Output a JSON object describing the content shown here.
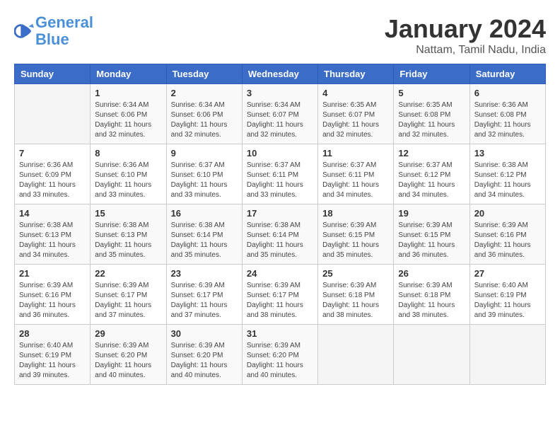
{
  "header": {
    "logo_line1": "General",
    "logo_line2": "Blue",
    "month_title": "January 2024",
    "subtitle": "Nattam, Tamil Nadu, India"
  },
  "weekdays": [
    "Sunday",
    "Monday",
    "Tuesday",
    "Wednesday",
    "Thursday",
    "Friday",
    "Saturday"
  ],
  "weeks": [
    [
      {
        "day": "",
        "info": ""
      },
      {
        "day": "1",
        "info": "Sunrise: 6:34 AM\nSunset: 6:06 PM\nDaylight: 11 hours\nand 32 minutes."
      },
      {
        "day": "2",
        "info": "Sunrise: 6:34 AM\nSunset: 6:06 PM\nDaylight: 11 hours\nand 32 minutes."
      },
      {
        "day": "3",
        "info": "Sunrise: 6:34 AM\nSunset: 6:07 PM\nDaylight: 11 hours\nand 32 minutes."
      },
      {
        "day": "4",
        "info": "Sunrise: 6:35 AM\nSunset: 6:07 PM\nDaylight: 11 hours\nand 32 minutes."
      },
      {
        "day": "5",
        "info": "Sunrise: 6:35 AM\nSunset: 6:08 PM\nDaylight: 11 hours\nand 32 minutes."
      },
      {
        "day": "6",
        "info": "Sunrise: 6:36 AM\nSunset: 6:08 PM\nDaylight: 11 hours\nand 32 minutes."
      }
    ],
    [
      {
        "day": "7",
        "info": "Sunrise: 6:36 AM\nSunset: 6:09 PM\nDaylight: 11 hours\nand 33 minutes."
      },
      {
        "day": "8",
        "info": "Sunrise: 6:36 AM\nSunset: 6:10 PM\nDaylight: 11 hours\nand 33 minutes."
      },
      {
        "day": "9",
        "info": "Sunrise: 6:37 AM\nSunset: 6:10 PM\nDaylight: 11 hours\nand 33 minutes."
      },
      {
        "day": "10",
        "info": "Sunrise: 6:37 AM\nSunset: 6:11 PM\nDaylight: 11 hours\nand 33 minutes."
      },
      {
        "day": "11",
        "info": "Sunrise: 6:37 AM\nSunset: 6:11 PM\nDaylight: 11 hours\nand 34 minutes."
      },
      {
        "day": "12",
        "info": "Sunrise: 6:37 AM\nSunset: 6:12 PM\nDaylight: 11 hours\nand 34 minutes."
      },
      {
        "day": "13",
        "info": "Sunrise: 6:38 AM\nSunset: 6:12 PM\nDaylight: 11 hours\nand 34 minutes."
      }
    ],
    [
      {
        "day": "14",
        "info": "Sunrise: 6:38 AM\nSunset: 6:13 PM\nDaylight: 11 hours\nand 34 minutes."
      },
      {
        "day": "15",
        "info": "Sunrise: 6:38 AM\nSunset: 6:13 PM\nDaylight: 11 hours\nand 35 minutes."
      },
      {
        "day": "16",
        "info": "Sunrise: 6:38 AM\nSunset: 6:14 PM\nDaylight: 11 hours\nand 35 minutes."
      },
      {
        "day": "17",
        "info": "Sunrise: 6:38 AM\nSunset: 6:14 PM\nDaylight: 11 hours\nand 35 minutes."
      },
      {
        "day": "18",
        "info": "Sunrise: 6:39 AM\nSunset: 6:15 PM\nDaylight: 11 hours\nand 35 minutes."
      },
      {
        "day": "19",
        "info": "Sunrise: 6:39 AM\nSunset: 6:15 PM\nDaylight: 11 hours\nand 36 minutes."
      },
      {
        "day": "20",
        "info": "Sunrise: 6:39 AM\nSunset: 6:16 PM\nDaylight: 11 hours\nand 36 minutes."
      }
    ],
    [
      {
        "day": "21",
        "info": "Sunrise: 6:39 AM\nSunset: 6:16 PM\nDaylight: 11 hours\nand 36 minutes."
      },
      {
        "day": "22",
        "info": "Sunrise: 6:39 AM\nSunset: 6:17 PM\nDaylight: 11 hours\nand 37 minutes."
      },
      {
        "day": "23",
        "info": "Sunrise: 6:39 AM\nSunset: 6:17 PM\nDaylight: 11 hours\nand 37 minutes."
      },
      {
        "day": "24",
        "info": "Sunrise: 6:39 AM\nSunset: 6:17 PM\nDaylight: 11 hours\nand 38 minutes."
      },
      {
        "day": "25",
        "info": "Sunrise: 6:39 AM\nSunset: 6:18 PM\nDaylight: 11 hours\nand 38 minutes."
      },
      {
        "day": "26",
        "info": "Sunrise: 6:39 AM\nSunset: 6:18 PM\nDaylight: 11 hours\nand 38 minutes."
      },
      {
        "day": "27",
        "info": "Sunrise: 6:40 AM\nSunset: 6:19 PM\nDaylight: 11 hours\nand 39 minutes."
      }
    ],
    [
      {
        "day": "28",
        "info": "Sunrise: 6:40 AM\nSunset: 6:19 PM\nDaylight: 11 hours\nand 39 minutes."
      },
      {
        "day": "29",
        "info": "Sunrise: 6:39 AM\nSunset: 6:20 PM\nDaylight: 11 hours\nand 40 minutes."
      },
      {
        "day": "30",
        "info": "Sunrise: 6:39 AM\nSunset: 6:20 PM\nDaylight: 11 hours\nand 40 minutes."
      },
      {
        "day": "31",
        "info": "Sunrise: 6:39 AM\nSunset: 6:20 PM\nDaylight: 11 hours\nand 40 minutes."
      },
      {
        "day": "",
        "info": ""
      },
      {
        "day": "",
        "info": ""
      },
      {
        "day": "",
        "info": ""
      }
    ]
  ]
}
